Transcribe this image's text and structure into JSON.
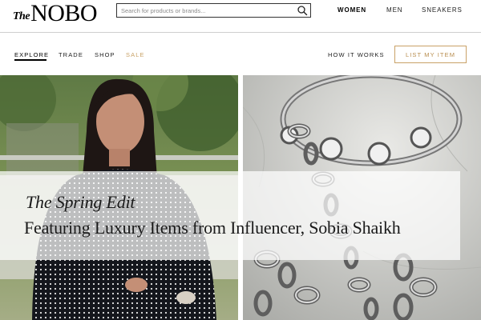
{
  "header": {
    "logo_prefix": "The",
    "logo_main": "NOBO",
    "search_placeholder": "Search for products or brands...",
    "gender_nav": [
      "WOMEN",
      "MEN",
      "SNEAKERS"
    ],
    "active_gender": "WOMEN"
  },
  "subnav": {
    "items": [
      "EXPLORE",
      "TRADE",
      "SHOP",
      "SALE"
    ],
    "active": "EXPLORE",
    "how_it_works": "HOW IT WORKS",
    "list_item_button": "LIST MY ITEM"
  },
  "hero": {
    "kicker": "The Spring Edit",
    "title": "Featuring Luxury Items from Influencer, Sobia Shaikh"
  },
  "colors": {
    "accent_gold": "#c9a267",
    "text": "#111111",
    "divider": "#cfcfcf"
  },
  "icons": {
    "search": "search-icon"
  }
}
